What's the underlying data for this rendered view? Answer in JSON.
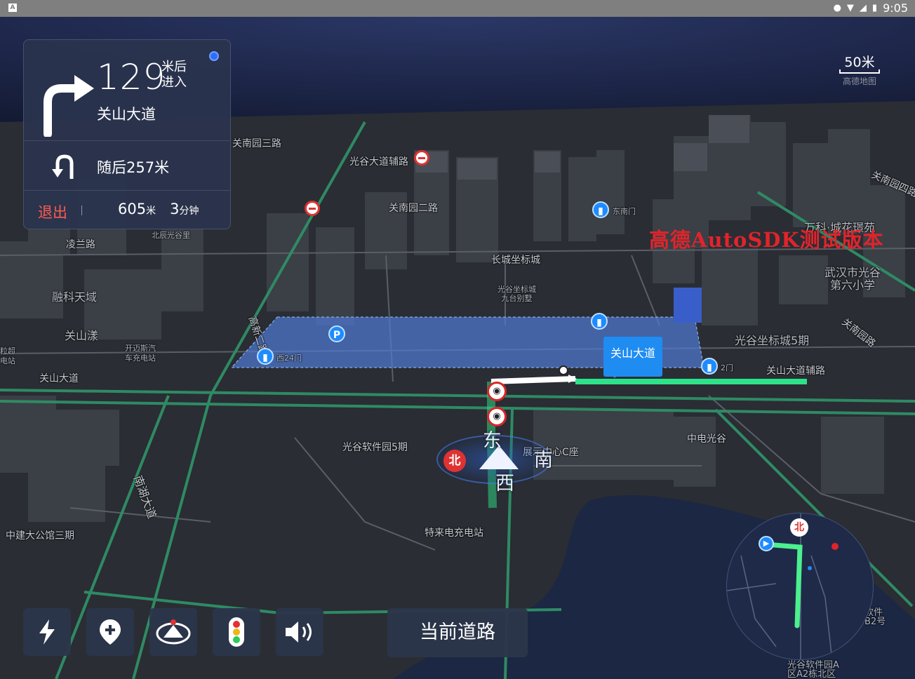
{
  "status_bar": {
    "time": "9:05",
    "app_icon": "A",
    "icons": [
      "location-icon",
      "wifi-icon",
      "signal-icon",
      "battery-icon"
    ]
  },
  "guidance": {
    "turn": "turn-right",
    "distance": "129",
    "distance_unit_top": "米后",
    "distance_unit_bottom": "进入",
    "road": "关山大道",
    "next_maneuver": "u-turn",
    "next_text": "随后257米",
    "exit_label": "退出",
    "remaining_distance": "605",
    "remaining_distance_unit": "米",
    "remaining_time": "3",
    "remaining_time_unit": "分钟"
  },
  "scale": {
    "value": "50米",
    "logo": "高德地图"
  },
  "watermark": "高德AutoSDK测试版本",
  "road_callout": "关山大道",
  "compass": {
    "east": "东",
    "south": "南",
    "west": "西",
    "north": "北"
  },
  "map_labels": {
    "guannan3": "关南园三路",
    "guanggu_fulu": "光谷大道辅路",
    "guannan2": "关南园二路",
    "lingnan": "凌兰路",
    "beichen": "北辰光谷里",
    "rongke": "融科天域",
    "guanshanyang": "关山漾",
    "kaimai": "开迈斯汽\n车充电站",
    "la_chao": "粒超\n电站",
    "guanshan_road": "关山大道",
    "changcheng": "长城坐标城",
    "jiutai": "光谷坐标城\n九台别墅",
    "wanke": "万科·城花璟苑",
    "wuhan_school": "武汉市光谷\n第六小学",
    "guanggu5": "光谷坐标城5期",
    "guannan4": "关南园四路",
    "guannan_road": "关南园路",
    "fulu": "关山大道辅路",
    "software5": "光谷软件园5期",
    "exhibit": "展示中心C座",
    "zhongdian": "中电光谷",
    "tele": "特来电充电站",
    "zhongjian": "中建大公馆三期",
    "nanhu": "南湖大道",
    "gaoxin2": "高新二路",
    "dongnanmen": "东南门",
    "gate2": "2门",
    "west24": "西24门",
    "software_a": "光谷软件园A\n区A2栋北区",
    "software_b2": "软件\nB2号"
  },
  "controls": {
    "buttons": [
      "lightning-icon",
      "add-location-icon",
      "view-mode-icon",
      "traffic-light-icon",
      "volume-icon"
    ],
    "current_road_label": "当前道路"
  },
  "minimap": {
    "north": "北"
  },
  "colors": {
    "route": "#2ee28a",
    "accent": "#1f8cf2",
    "exit": "#ff5a4f",
    "watermark": "#e0242b"
  }
}
